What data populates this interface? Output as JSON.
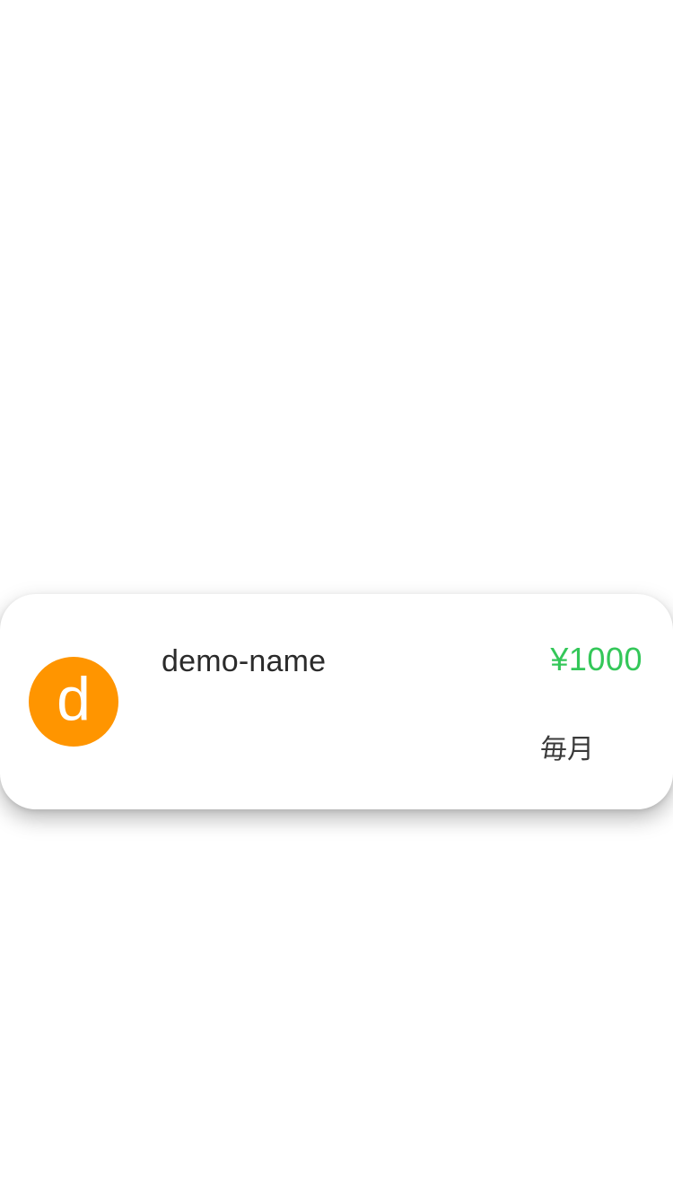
{
  "colors": {
    "avatar_bg": "#FF9500",
    "amount": "#34C759"
  },
  "item": {
    "avatar_letter": "d",
    "name": "demo-name",
    "amount": "¥1000",
    "period": "毎月"
  }
}
